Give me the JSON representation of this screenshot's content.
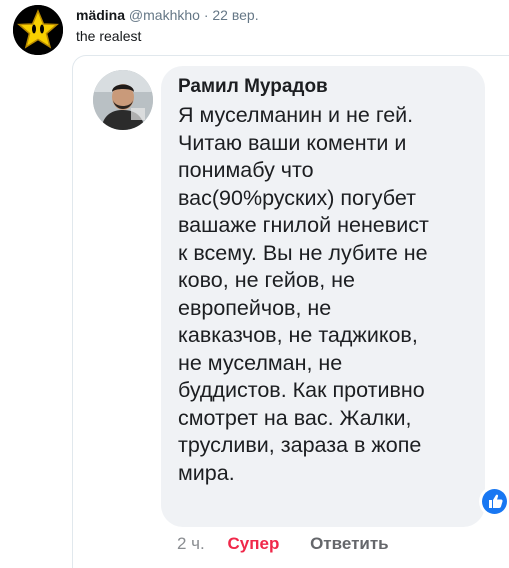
{
  "tweet": {
    "avatar_icon": "star-icon",
    "display_name": "mädina",
    "handle": "@makhkho",
    "separator": "·",
    "date": "22 вер.",
    "text": "the realest"
  },
  "fb_comment": {
    "avatar": "profile-photo",
    "commenter_name": "Рамил Мурадов",
    "lines": [
      "Я муселманин и не гей.",
      "Читаю ваши коменти и",
      "понимабу что",
      "вас(90%руских) погубет",
      "вашаже гнилой неневист",
      "к всему. Вы не лубите не",
      "ково, не гейов, не",
      "европейчов, не",
      "кавказчов, не таджиков,",
      "не муселман, не",
      "буддистов. Как противно",
      "смотрет на вас. Жалки,",
      "трусливи, зараза в жопе",
      "мира."
    ],
    "reaction_icon": "like-icon",
    "time": "2 ч.",
    "reaction_label": "Супер",
    "reply_label": "Ответить"
  },
  "colors": {
    "tweet_text": "#14171a",
    "tweet_secondary": "#657786",
    "bubble_bg": "#f0f2f5",
    "reaction_super": "#f0284a",
    "fb_blue": "#1877f2"
  }
}
